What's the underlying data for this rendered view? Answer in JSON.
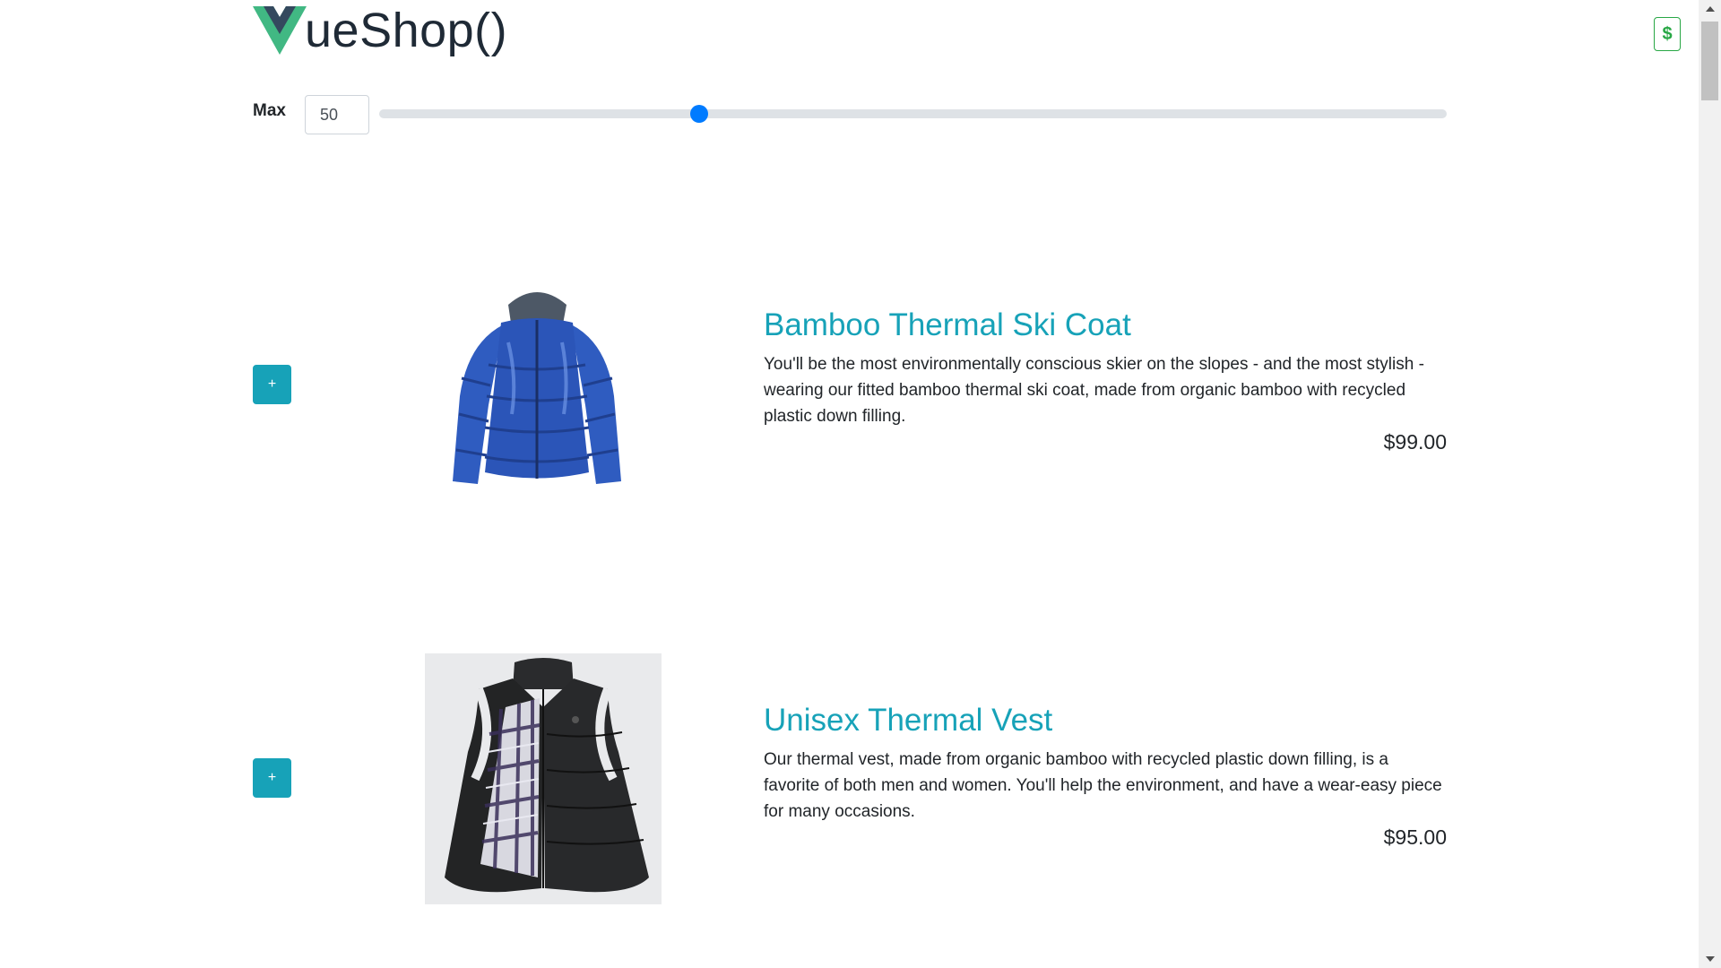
{
  "brand": {
    "text": "ueShop()"
  },
  "cart": {
    "label": "$"
  },
  "filter": {
    "label": "Max",
    "value": "50",
    "slider_fraction": 0.3
  },
  "products": [
    {
      "name": "Bamboo Thermal Ski Coat",
      "description": "You'll be the most environmentally conscious skier on the slopes - and the most stylish - wearing our fitted bamboo thermal ski coat, made from organic bamboo with recycled plastic down filling.",
      "price": "$99.00",
      "add_label": "+"
    },
    {
      "name": "Unisex Thermal Vest",
      "description": "Our thermal vest, made from organic bamboo with recycled plastic down filling, is a favorite of both men and women. You'll help the environment, and have a wear-easy piece for many occasions.",
      "price": "$95.00",
      "add_label": "+"
    }
  ],
  "colors": {
    "accent": "#17a2b8",
    "slider": "#007bff",
    "cart": "#28a745",
    "vue_green": "#41b883",
    "vue_dark": "#34495e"
  }
}
